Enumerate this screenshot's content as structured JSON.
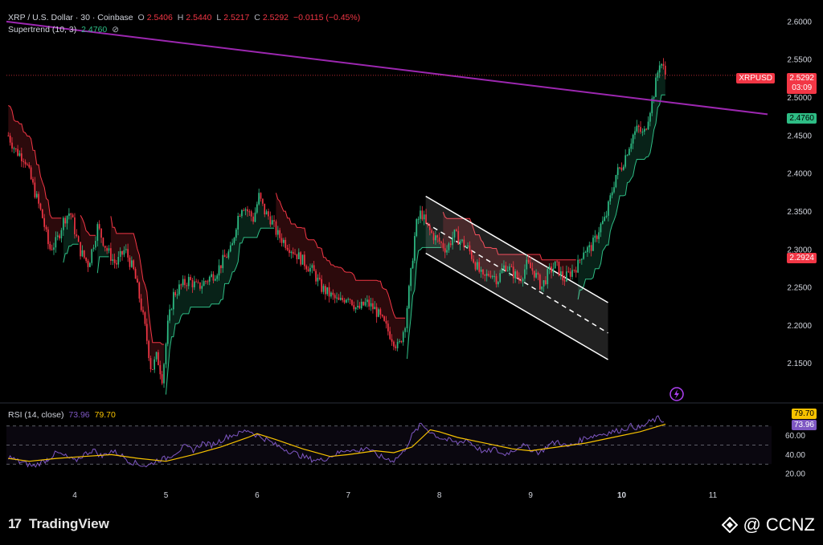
{
  "header": {
    "symbol_line": "XRP / U.S. Dollar · 30 · Coinbase",
    "open_label": "O",
    "open": "2.5406",
    "high_label": "H",
    "high": "2.5440",
    "low_label": "L",
    "low": "2.5217",
    "close_label": "C",
    "close": "2.5292",
    "change": "−0.0115 (−0.45%)",
    "indicator_label": "Supertrend (10, 3)",
    "indicator_value": "2.4760"
  },
  "rsi_header": {
    "label": "RSI (14, close)",
    "rsi": "73.96",
    "ma": "79.70"
  },
  "price_tags": {
    "symbol": "XRPUSD",
    "last_price": "2.5292",
    "countdown": "03:09",
    "supertrend": "2.4760",
    "marked_level": "2.2924"
  },
  "rsi_tags": {
    "ma": "79.70",
    "rsi": "73.96"
  },
  "footer": {
    "brand": "TradingView",
    "watermark": "@ CCNZ"
  },
  "colors": {
    "up": "#2ebd85",
    "down": "#f23645",
    "trendline": "#9c27b0",
    "rsi": "#7e57c2",
    "rsi_ma": "#f7c200",
    "channel": "#ffffff"
  },
  "chart_data": [
    {
      "type": "candlestick",
      "title": "XRP / U.S. Dollar · 30 · Coinbase",
      "x_ticks": [
        "4",
        "5",
        "6",
        "7",
        "8",
        "9",
        "10",
        "11"
      ],
      "y_ticks": [
        "2.6000",
        "2.5500",
        "2.5000",
        "2.4500",
        "2.4000",
        "2.3500",
        "2.3000",
        "2.2500",
        "2.2000",
        "2.1500"
      ],
      "ylim": [
        2.1,
        2.62
      ],
      "xlim": [
        3.25,
        11.6
      ],
      "close_path": [
        [
          3.27,
          2.45
        ],
        [
          3.35,
          2.43
        ],
        [
          3.45,
          2.42
        ],
        [
          3.55,
          2.38
        ],
        [
          3.65,
          2.34
        ],
        [
          3.72,
          2.3
        ],
        [
          3.8,
          2.31
        ],
        [
          3.88,
          2.34
        ],
        [
          3.95,
          2.35
        ],
        [
          4.05,
          2.3
        ],
        [
          4.15,
          2.28
        ],
        [
          4.25,
          2.33
        ],
        [
          4.35,
          2.3
        ],
        [
          4.45,
          2.28
        ],
        [
          4.55,
          2.3
        ],
        [
          4.65,
          2.27
        ],
        [
          4.72,
          2.23
        ],
        [
          4.78,
          2.19
        ],
        [
          4.84,
          2.14
        ],
        [
          4.9,
          2.16
        ],
        [
          4.96,
          2.13
        ],
        [
          5.02,
          2.2
        ],
        [
          5.08,
          2.24
        ],
        [
          5.15,
          2.25
        ],
        [
          5.25,
          2.26
        ],
        [
          5.35,
          2.25
        ],
        [
          5.45,
          2.26
        ],
        [
          5.55,
          2.27
        ],
        [
          5.65,
          2.29
        ],
        [
          5.72,
          2.3
        ],
        [
          5.78,
          2.34
        ],
        [
          5.84,
          2.36
        ],
        [
          5.9,
          2.35
        ],
        [
          5.96,
          2.34
        ],
        [
          6.02,
          2.37
        ],
        [
          6.08,
          2.35
        ],
        [
          6.15,
          2.34
        ],
        [
          6.22,
          2.32
        ],
        [
          6.3,
          2.31
        ],
        [
          6.38,
          2.3
        ],
        [
          6.46,
          2.29
        ],
        [
          6.54,
          2.28
        ],
        [
          6.62,
          2.27
        ],
        [
          6.7,
          2.25
        ],
        [
          6.8,
          2.24
        ],
        [
          6.9,
          2.23
        ],
        [
          7.0,
          2.24
        ],
        [
          7.1,
          2.22
        ],
        [
          7.2,
          2.23
        ],
        [
          7.3,
          2.22
        ],
        [
          7.4,
          2.2
        ],
        [
          7.5,
          2.18
        ],
        [
          7.55,
          2.17
        ],
        [
          7.62,
          2.2
        ],
        [
          7.68,
          2.26
        ],
        [
          7.74,
          2.33
        ],
        [
          7.8,
          2.35
        ],
        [
          7.86,
          2.33
        ],
        [
          7.92,
          2.32
        ],
        [
          8.0,
          2.31
        ],
        [
          8.08,
          2.3
        ],
        [
          8.16,
          2.32
        ],
        [
          8.24,
          2.31
        ],
        [
          8.32,
          2.3
        ],
        [
          8.4,
          2.28
        ],
        [
          8.48,
          2.26
        ],
        [
          8.56,
          2.27
        ],
        [
          8.64,
          2.26
        ],
        [
          8.72,
          2.28
        ],
        [
          8.8,
          2.27
        ],
        [
          8.88,
          2.26
        ],
        [
          8.96,
          2.28
        ],
        [
          9.04,
          2.27
        ],
        [
          9.12,
          2.25
        ],
        [
          9.2,
          2.27
        ],
        [
          9.28,
          2.28
        ],
        [
          9.36,
          2.26
        ],
        [
          9.44,
          2.27
        ],
        [
          9.52,
          2.28
        ],
        [
          9.58,
          2.3
        ],
        [
          9.64,
          2.3
        ],
        [
          9.7,
          2.31
        ],
        [
          9.76,
          2.33
        ],
        [
          9.82,
          2.34
        ],
        [
          9.88,
          2.37
        ],
        [
          9.94,
          2.4
        ],
        [
          10.0,
          2.41
        ],
        [
          10.06,
          2.43
        ],
        [
          10.12,
          2.45
        ],
        [
          10.18,
          2.46
        ],
        [
          10.24,
          2.45
        ],
        [
          10.3,
          2.48
        ],
        [
          10.36,
          2.51
        ],
        [
          10.42,
          2.55
        ],
        [
          10.48,
          2.53
        ]
      ],
      "trendline": [
        [
          3.25,
          2.6
        ],
        [
          11.6,
          2.478
        ]
      ],
      "descending_channel": {
        "upper": [
          [
            7.85,
            2.37
          ],
          [
            9.85,
            2.23
          ]
        ],
        "lower": [
          [
            7.85,
            2.295
          ],
          [
            9.85,
            2.155
          ]
        ],
        "mid": [
          [
            7.85,
            2.335
          ],
          [
            9.85,
            2.19
          ]
        ]
      },
      "last_price_line": 2.5292,
      "series": [
        {
          "name": "Supertrend (10, 3)",
          "last": 2.476
        }
      ]
    },
    {
      "type": "line",
      "title": "RSI (14, close)",
      "y_ticks": [
        "60.00",
        "40.00",
        "20.00"
      ],
      "ylim": [
        20,
        80
      ],
      "bands": [
        30,
        70
      ],
      "series": [
        {
          "name": "RSI",
          "last": 73.96,
          "values": [
            [
              3.27,
              38
            ],
            [
              3.4,
              32
            ],
            [
              3.55,
              28
            ],
            [
              3.7,
              35
            ],
            [
              3.8,
              42
            ],
            [
              3.9,
              38
            ],
            [
              4.0,
              33
            ],
            [
              4.1,
              40
            ],
            [
              4.2,
              45
            ],
            [
              4.3,
              38
            ],
            [
              4.4,
              44
            ],
            [
              4.5,
              40
            ],
            [
              4.6,
              33
            ],
            [
              4.7,
              30
            ],
            [
              4.8,
              28
            ],
            [
              4.9,
              34
            ],
            [
              5.0,
              36
            ],
            [
              5.1,
              42
            ],
            [
              5.2,
              48
            ],
            [
              5.3,
              45
            ],
            [
              5.4,
              52
            ],
            [
              5.5,
              50
            ],
            [
              5.6,
              55
            ],
            [
              5.7,
              60
            ],
            [
              5.8,
              62
            ],
            [
              5.9,
              66
            ],
            [
              6.0,
              60
            ],
            [
              6.1,
              56
            ],
            [
              6.2,
              50
            ],
            [
              6.3,
              46
            ],
            [
              6.4,
              42
            ],
            [
              6.5,
              38
            ],
            [
              6.6,
              35
            ],
            [
              6.7,
              34
            ],
            [
              6.8,
              38
            ],
            [
              6.9,
              42
            ],
            [
              7.0,
              46
            ],
            [
              7.1,
              43
            ],
            [
              7.2,
              48
            ],
            [
              7.3,
              40
            ],
            [
              7.4,
              36
            ],
            [
              7.5,
              34
            ],
            [
              7.6,
              42
            ],
            [
              7.7,
              60
            ],
            [
              7.8,
              72
            ],
            [
              7.9,
              64
            ],
            [
              8.0,
              58
            ],
            [
              8.1,
              55
            ],
            [
              8.2,
              52
            ],
            [
              8.3,
              56
            ],
            [
              8.4,
              48
            ],
            [
              8.5,
              42
            ],
            [
              8.6,
              46
            ],
            [
              8.7,
              40
            ],
            [
              8.8,
              44
            ],
            [
              8.9,
              50
            ],
            [
              9.0,
              46
            ],
            [
              9.1,
              42
            ],
            [
              9.2,
              50
            ],
            [
              9.3,
              54
            ],
            [
              9.4,
              48
            ],
            [
              9.5,
              52
            ],
            [
              9.6,
              58
            ],
            [
              9.7,
              60
            ],
            [
              9.8,
              62
            ],
            [
              9.9,
              64
            ],
            [
              10.0,
              66
            ],
            [
              10.1,
              70
            ],
            [
              10.2,
              68
            ],
            [
              10.3,
              74
            ],
            [
              10.4,
              78
            ],
            [
              10.48,
              74
            ]
          ]
        },
        {
          "name": "MA",
          "last": 79.7,
          "values": [
            [
              3.27,
              36
            ],
            [
              3.5,
              33
            ],
            [
              3.8,
              36
            ],
            [
              4.1,
              38
            ],
            [
              4.4,
              40
            ],
            [
              4.7,
              36
            ],
            [
              5.0,
              33
            ],
            [
              5.3,
              40
            ],
            [
              5.6,
              48
            ],
            [
              5.9,
              58
            ],
            [
              6.0,
              62
            ],
            [
              6.2,
              56
            ],
            [
              6.5,
              46
            ],
            [
              6.8,
              38
            ],
            [
              7.0,
              40
            ],
            [
              7.3,
              44
            ],
            [
              7.5,
              42
            ],
            [
              7.7,
              48
            ],
            [
              7.9,
              66
            ],
            [
              8.0,
              64
            ],
            [
              8.2,
              58
            ],
            [
              8.5,
              52
            ],
            [
              8.8,
              46
            ],
            [
              9.0,
              44
            ],
            [
              9.3,
              48
            ],
            [
              9.6,
              52
            ],
            [
              9.9,
              58
            ],
            [
              10.2,
              64
            ],
            [
              10.48,
              72
            ]
          ]
        }
      ]
    }
  ]
}
